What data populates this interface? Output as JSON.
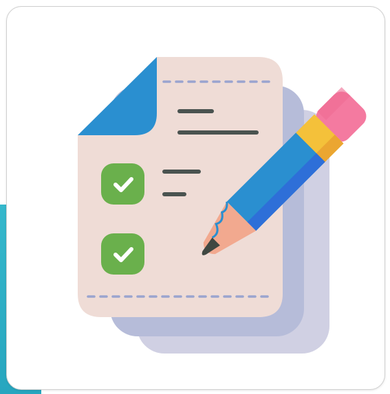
{
  "card": {
    "description_icon": "checklist-with-pencil-icon"
  },
  "checklist": {
    "items": [
      {
        "checked": true,
        "icon": "check-icon"
      },
      {
        "checked": true,
        "icon": "check-icon"
      }
    ]
  },
  "colors": {
    "band_teal": "#2faec4",
    "card_border": "#cfcfcf",
    "paper": "#efdcd6",
    "paper_shadow": "#b6bcd9",
    "paper_back": "#d0d0e3",
    "fold_blue": "#2a8fd0",
    "checkbox_green": "#6ab04c",
    "text_line": "#4a5350",
    "dash": "#9aa4cf",
    "pencil_body": "#2a8fd0",
    "pencil_dark": "#2e6fd8",
    "pencil_band": "#f4c13a",
    "pencil_eraser": "#f47aa0",
    "pencil_wood": "#f2a98f",
    "pencil_lead": "#404842"
  }
}
